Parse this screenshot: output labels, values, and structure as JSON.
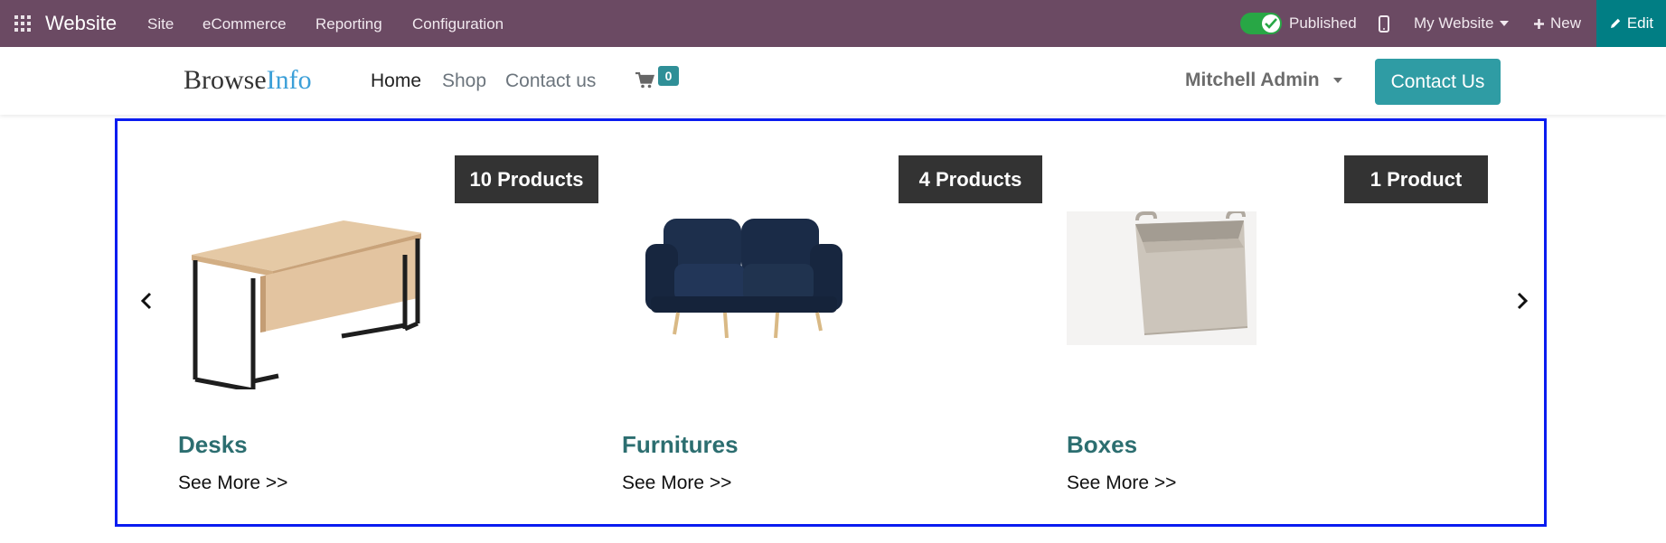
{
  "admin_bar": {
    "app_title": "Website",
    "menu": [
      "Site",
      "eCommerce",
      "Reporting",
      "Configuration"
    ],
    "published_label": "Published",
    "website_selector": "My Website",
    "new_label": "New",
    "edit_label": "Edit",
    "bar_color": "#6b4a63",
    "edit_color": "#017e84"
  },
  "header": {
    "logo_part1": "Browse",
    "logo_part2": "Info",
    "nav": [
      "Home",
      "Shop",
      "Contact us"
    ],
    "active_nav": "Home",
    "cart_count": "0",
    "user_name": "Mitchell Admin",
    "contact_button": "Contact Us"
  },
  "carousel": {
    "items": [
      {
        "badge": "10 Products",
        "title": "Desks",
        "link": "See More >>",
        "image": "desk"
      },
      {
        "badge": "4 Products",
        "title": "Furnitures",
        "link": "See More >>",
        "image": "sofa"
      },
      {
        "badge": "1 Product",
        "title": "Boxes",
        "link": "See More >>",
        "image": "storage-box"
      }
    ],
    "border_color": "#0a1cf0",
    "title_color": "#2c6e70"
  }
}
